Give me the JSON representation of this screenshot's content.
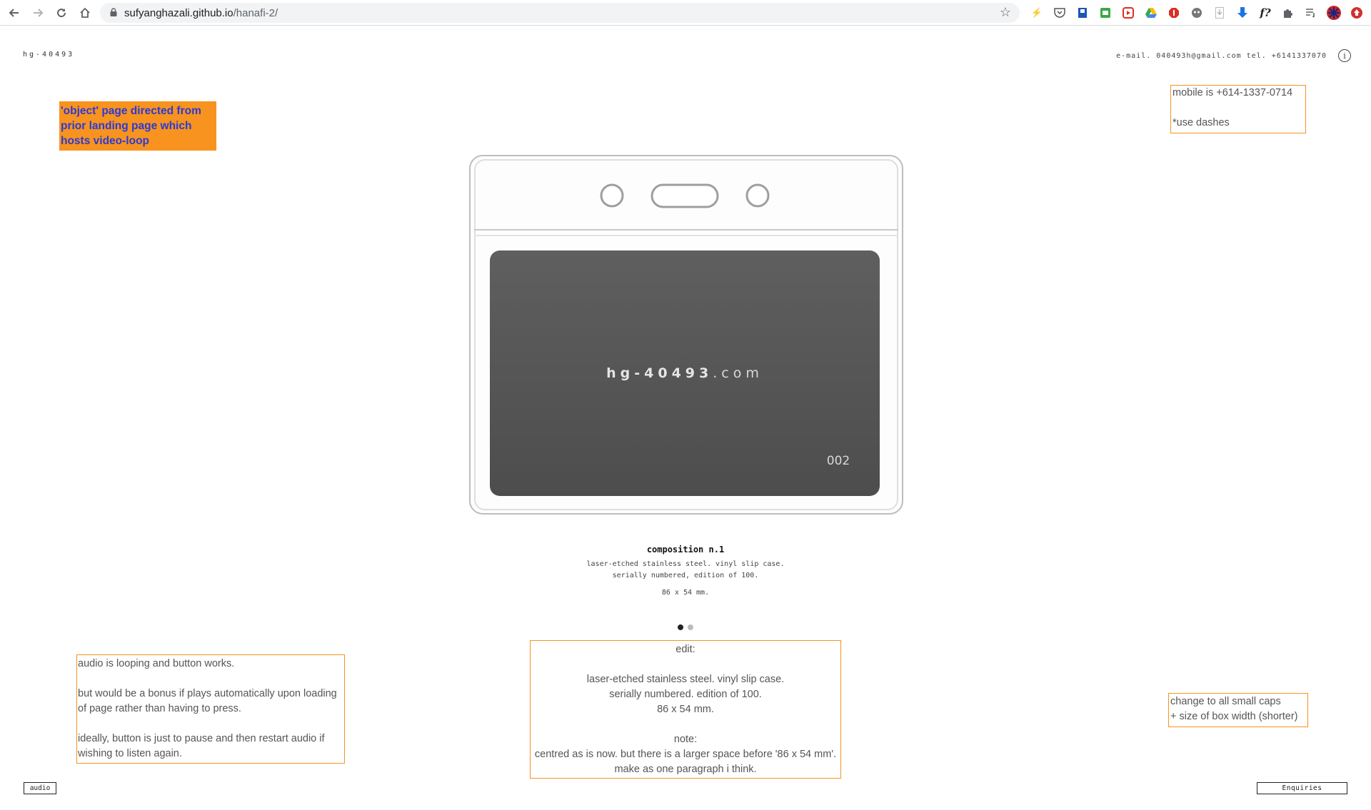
{
  "browser": {
    "url_host": "sufyanghazali.github.io",
    "url_path": "/hanafi-2/",
    "back_icon": "arrow-left-icon",
    "forward_icon": "arrow-right-icon",
    "reload_icon": "reload-icon",
    "home_icon": "home-icon",
    "star_icon": "star-icon",
    "extensions": [
      "bolt-icon",
      "pocket-icon",
      "book-icon",
      "printer-icon",
      "record-icon",
      "drive-icon",
      "stop-icon",
      "cat-icon",
      "download-icon",
      "download-blue-icon",
      "f-icon",
      "puzzle-icon",
      "playlist-icon",
      "avatar-icon",
      "red-ext-icon"
    ],
    "f_label": "f?"
  },
  "header": {
    "site_id": "hg-40493",
    "contact": "e-mail. 040493h@gmail.com  tel. +6141337070",
    "info_glyph": "i"
  },
  "notes": {
    "orange": "'object' page directed from prior landing page which hosts video-loop",
    "mobile": "mobile is +614-1337-0714\n\n*use dashes",
    "audio": "audio is looping and button works.\n\nbut would be a bonus if plays automatically upon loading of page rather than having to press.\n\nideally, button is just to pause and then restart audio if wishing to listen again.",
    "edit": "edit:\n\nlaser-etched stainless steel. vinyl slip case.\nserially numbered. edition of 100.\n86 x 54 mm.\n\nnote:\ncentred as is now. but there is a larger space before '86 x 54 mm'.\nmake as one paragraph i think.",
    "caps": "change to all small caps\n+ size of  box width (shorter)"
  },
  "product": {
    "card_text_bold": "hg-40493",
    "card_text_light": ".com",
    "serial": "002",
    "title": "composition n.1",
    "line1": "laser-etched stainless steel. vinyl slip case.",
    "line2": "serially numbered, edition of 100.",
    "dimensions": "86 x 54 mm."
  },
  "carousel": {
    "count": 2,
    "active": 1
  },
  "buttons": {
    "audio": "audio",
    "enquiries": "Enquiries"
  }
}
